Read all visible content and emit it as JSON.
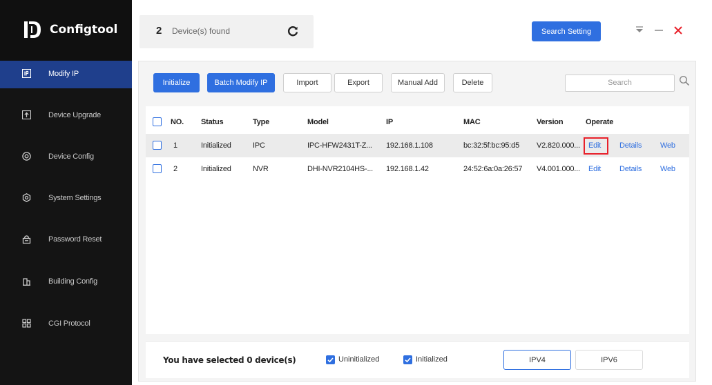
{
  "app": {
    "name": "Configtool"
  },
  "sidebar": {
    "items": [
      {
        "label": "Modify IP",
        "icon": "ip-icon",
        "active": true
      },
      {
        "label": "Device Upgrade",
        "icon": "upload-icon",
        "active": false
      },
      {
        "label": "Device Config",
        "icon": "config-icon",
        "active": false
      },
      {
        "label": "System Settings",
        "icon": "settings-icon",
        "active": false
      },
      {
        "label": "Password Reset",
        "icon": "lock-icon",
        "active": false
      },
      {
        "label": "Building Config",
        "icon": "building-icon",
        "active": false
      },
      {
        "label": "CGI Protocol",
        "icon": "grid-icon",
        "active": false
      }
    ]
  },
  "header": {
    "device_count": "2",
    "device_label": "Device(s) found",
    "search_setting_label": "Search Setting"
  },
  "toolbar": {
    "initialize": "Initialize",
    "batch_modify_ip": "Batch Modify IP",
    "import": "Import",
    "export": "Export",
    "manual_add": "Manual Add",
    "delete": "Delete",
    "search_placeholder": "Search"
  },
  "table": {
    "columns": [
      "NO.",
      "Status",
      "Type",
      "Model",
      "IP",
      "MAC",
      "Version",
      "Operate"
    ],
    "rows": [
      {
        "no": "1",
        "status": "Initialized",
        "type": "IPC",
        "model": "IPC-HFW2431T-Z...",
        "ip": "192.168.1.108",
        "mac": "bc:32:5f:bc:95:d5",
        "version": "V2.820.000...",
        "edit": "Edit",
        "details": "Details",
        "web": "Web"
      },
      {
        "no": "2",
        "status": "Initialized",
        "type": "NVR",
        "model": "DHI-NVR2104HS-...",
        "ip": "192.168.1.42",
        "mac": "24:52:6a:0a:26:57",
        "version": "V4.001.000...",
        "edit": "Edit",
        "details": "Details",
        "web": "Web"
      }
    ]
  },
  "footer": {
    "selected_text": "You have selected 0 device(s)",
    "uninitialized_label": "Uninitialized",
    "initialized_label": "Initialized",
    "ipv4": "IPV4",
    "ipv6": "IPV6"
  },
  "colors": {
    "accent": "#2f6fe0",
    "sidebar_bg": "#141414",
    "sidebar_active": "#1f3f8c",
    "close": "#e8202a",
    "highlight": "#e8202a"
  }
}
